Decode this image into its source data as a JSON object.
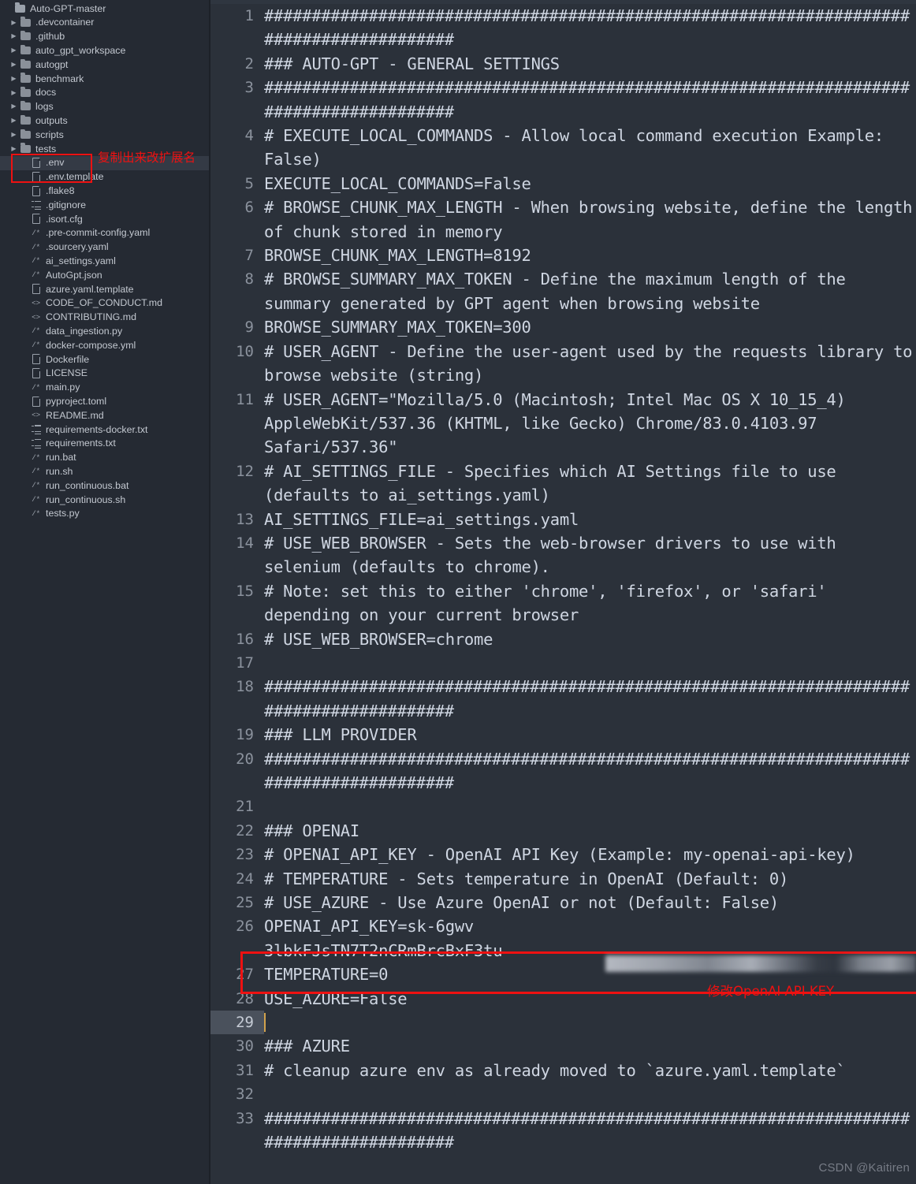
{
  "sidebar": {
    "root": {
      "label": "Auto-GPT-master",
      "icon": "folder-open-icon"
    },
    "folders": [
      {
        "label": ".devcontainer",
        "icon": "folder-icon"
      },
      {
        "label": ".github",
        "icon": "folder-icon"
      },
      {
        "label": "auto_gpt_workspace",
        "icon": "folder-icon"
      },
      {
        "label": "autogpt",
        "icon": "folder-icon"
      },
      {
        "label": "benchmark",
        "icon": "folder-icon"
      },
      {
        "label": "docs",
        "icon": "folder-icon"
      },
      {
        "label": "logs",
        "icon": "folder-icon"
      },
      {
        "label": "outputs",
        "icon": "folder-icon"
      },
      {
        "label": "scripts",
        "icon": "folder-icon"
      },
      {
        "label": "tests",
        "icon": "folder-icon"
      }
    ],
    "files": [
      {
        "label": ".env",
        "icon": "file-doc-icon",
        "selected": true
      },
      {
        "label": ".env.template",
        "icon": "file-doc-icon",
        "selected": false
      },
      {
        "label": ".flake8",
        "icon": "file-doc-icon",
        "selected": false
      },
      {
        "label": ".gitignore",
        "icon": "file-list-icon",
        "selected": false
      },
      {
        "label": ".isort.cfg",
        "icon": "file-doc-icon",
        "selected": false
      },
      {
        "label": ".pre-commit-config.yaml",
        "icon": "file-comment-icon",
        "selected": false
      },
      {
        "label": ".sourcery.yaml",
        "icon": "file-comment-icon",
        "selected": false
      },
      {
        "label": "ai_settings.yaml",
        "icon": "file-comment-icon",
        "selected": false
      },
      {
        "label": "AutoGpt.json",
        "icon": "file-comment-icon",
        "selected": false
      },
      {
        "label": "azure.yaml.template",
        "icon": "file-doc-icon",
        "selected": false
      },
      {
        "label": "CODE_OF_CONDUCT.md",
        "icon": "file-code-icon",
        "selected": false
      },
      {
        "label": "CONTRIBUTING.md",
        "icon": "file-code-icon",
        "selected": false
      },
      {
        "label": "data_ingestion.py",
        "icon": "file-comment-icon",
        "selected": false
      },
      {
        "label": "docker-compose.yml",
        "icon": "file-comment-icon",
        "selected": false
      },
      {
        "label": "Dockerfile",
        "icon": "file-doc-icon",
        "selected": false
      },
      {
        "label": "LICENSE",
        "icon": "file-doc-icon",
        "selected": false
      },
      {
        "label": "main.py",
        "icon": "file-comment-icon",
        "selected": false
      },
      {
        "label": "pyproject.toml",
        "icon": "file-doc-icon",
        "selected": false
      },
      {
        "label": "README.md",
        "icon": "file-code-icon",
        "selected": false
      },
      {
        "label": "requirements-docker.txt",
        "icon": "file-list-icon",
        "selected": false
      },
      {
        "label": "requirements.txt",
        "icon": "file-list-icon",
        "selected": false
      },
      {
        "label": "run.bat",
        "icon": "file-comment-icon",
        "selected": false
      },
      {
        "label": "run.sh",
        "icon": "file-comment-icon",
        "selected": false
      },
      {
        "label": "run_continuous.bat",
        "icon": "file-comment-icon",
        "selected": false
      },
      {
        "label": "run_continuous.sh",
        "icon": "file-comment-icon",
        "selected": false
      },
      {
        "label": "tests.py",
        "icon": "file-comment-icon",
        "selected": false
      }
    ]
  },
  "annotations": {
    "env_note": "复制出来改扩展名",
    "key_note": "修改OpenAI API KEY",
    "color": "#ee1111"
  },
  "editor": {
    "active_line": 29,
    "caret_line": 29,
    "lines": [
      {
        "n": 1,
        "text": "########################################################################################",
        "kind": "hashes"
      },
      {
        "n": 2,
        "text": "### AUTO-GPT - GENERAL SETTINGS",
        "kind": "code"
      },
      {
        "n": 3,
        "text": "########################################################################################",
        "kind": "hashes"
      },
      {
        "n": 4,
        "text": "# EXECUTE_LOCAL_COMMANDS - Allow local command execution Example: False)",
        "kind": "code"
      },
      {
        "n": 5,
        "text": "EXECUTE_LOCAL_COMMANDS=False",
        "kind": "code"
      },
      {
        "n": 6,
        "text": "# BROWSE_CHUNK_MAX_LENGTH - When browsing website, define the length of chunk stored in memory",
        "kind": "code"
      },
      {
        "n": 7,
        "text": "BROWSE_CHUNK_MAX_LENGTH=8192",
        "kind": "code"
      },
      {
        "n": 8,
        "text": "# BROWSE_SUMMARY_MAX_TOKEN - Define the maximum length of the summary generated by GPT agent when browsing website",
        "kind": "code"
      },
      {
        "n": 9,
        "text": "BROWSE_SUMMARY_MAX_TOKEN=300",
        "kind": "code"
      },
      {
        "n": 10,
        "text": "# USER_AGENT - Define the user-agent used by the requests library to browse website (string)",
        "kind": "code"
      },
      {
        "n": 11,
        "text": "# USER_AGENT=\"Mozilla/5.0 (Macintosh; Intel Mac OS X 10_15_4) AppleWebKit/537.36 (KHTML, like Gecko) Chrome/83.0.4103.97 Safari/537.36\"",
        "kind": "code"
      },
      {
        "n": 12,
        "text": "# AI_SETTINGS_FILE - Specifies which AI Settings file to use (defaults to ai_settings.yaml)",
        "kind": "code"
      },
      {
        "n": 13,
        "text": "AI_SETTINGS_FILE=ai_settings.yaml",
        "kind": "code"
      },
      {
        "n": 14,
        "text": "# USE_WEB_BROWSER - Sets the web-browser drivers to use with selenium (defaults to chrome).",
        "kind": "code"
      },
      {
        "n": 15,
        "text": "# Note: set this to either 'chrome', 'firefox', or 'safari' depending on your current browser",
        "kind": "code"
      },
      {
        "n": 16,
        "text": "# USE_WEB_BROWSER=chrome",
        "kind": "code"
      },
      {
        "n": 17,
        "text": "",
        "kind": "code"
      },
      {
        "n": 18,
        "text": "########################################################################################",
        "kind": "hashes"
      },
      {
        "n": 19,
        "text": "### LLM PROVIDER",
        "kind": "code"
      },
      {
        "n": 20,
        "text": "########################################################################################",
        "kind": "hashes"
      },
      {
        "n": 21,
        "text": "",
        "kind": "code"
      },
      {
        "n": 22,
        "text": "### OPENAI",
        "kind": "code"
      },
      {
        "n": 23,
        "text": "# OPENAI_API_KEY - OpenAI API Key (Example: my-openai-api-key)",
        "kind": "code"
      },
      {
        "n": 24,
        "text": "# TEMPERATURE - Sets temperature in OpenAI (Default: 0)",
        "kind": "code"
      },
      {
        "n": 25,
        "text": "# USE_AZURE - Use Azure OpenAI or not (Default: False)",
        "kind": "code"
      },
      {
        "n": 26,
        "text": "OPENAI_API_KEY=sk-6gwv                                 3lbkFJsTN7T2nCRmBrcBxF3tu",
        "kind": "code"
      },
      {
        "n": 27,
        "text": "TEMPERATURE=0",
        "kind": "code"
      },
      {
        "n": 28,
        "text": "USE_AZURE=False",
        "kind": "code"
      },
      {
        "n": 29,
        "text": "",
        "kind": "caret"
      },
      {
        "n": 30,
        "text": "### AZURE",
        "kind": "code"
      },
      {
        "n": 31,
        "text": "# cleanup azure env as already moved to `azure.yaml.template`",
        "kind": "code"
      },
      {
        "n": 32,
        "text": "",
        "kind": "code"
      },
      {
        "n": 33,
        "text": "########################################################################################",
        "kind": "hashes"
      }
    ]
  },
  "watermark": "CSDN @Kaitiren"
}
